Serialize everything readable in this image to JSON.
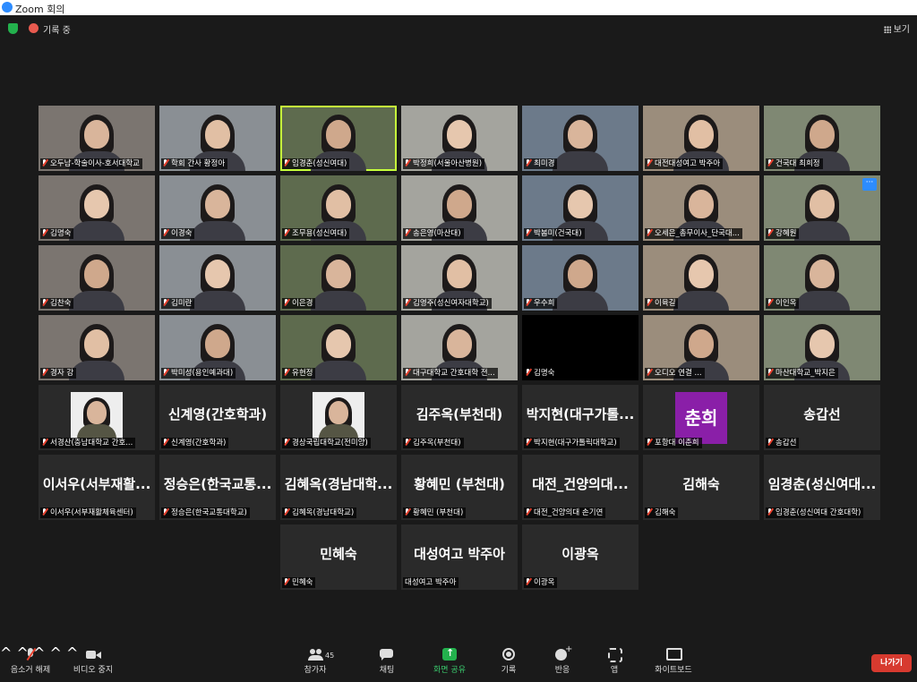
{
  "window": {
    "title": "Zoom 회의"
  },
  "topbar": {
    "recording": "기록 중",
    "view": "보기"
  },
  "participants": [
    {
      "label": "오두남-학술이사-호서대학교",
      "kind": "video"
    },
    {
      "label": "학회 간사 황정아",
      "kind": "video"
    },
    {
      "label": "임경춘(성신여대)",
      "kind": "video",
      "active": true
    },
    {
      "label": "박정희(서울아산병원)",
      "kind": "video"
    },
    {
      "label": "최미경",
      "kind": "video"
    },
    {
      "label": "대전대성여고 박주아",
      "kind": "video"
    },
    {
      "label": "건국대 최희정",
      "kind": "video"
    },
    {
      "label": "김명숙",
      "kind": "video"
    },
    {
      "label": "이경숙",
      "kind": "video"
    },
    {
      "label": "조무용(성신여대)",
      "kind": "video"
    },
    {
      "label": "송은영(마산대)",
      "kind": "video"
    },
    {
      "label": "박봄미(건국대)",
      "kind": "video"
    },
    {
      "label": "오세은_총무이사_단국대...",
      "kind": "video"
    },
    {
      "label": "강혜원",
      "kind": "video",
      "more": true
    },
    {
      "label": "김찬숙",
      "kind": "video"
    },
    {
      "label": "김미란",
      "kind": "video"
    },
    {
      "label": "이은경",
      "kind": "video"
    },
    {
      "label": "김영주(성신여자대학교)",
      "kind": "video"
    },
    {
      "label": "우수희",
      "kind": "video"
    },
    {
      "label": "이육길",
      "kind": "video"
    },
    {
      "label": "이인옥",
      "kind": "video"
    },
    {
      "label": "경자 강",
      "kind": "video"
    },
    {
      "label": "박미성(용인예과대)",
      "kind": "video"
    },
    {
      "label": "유현정",
      "kind": "video"
    },
    {
      "label": "대구대학교 간호대학 전...",
      "kind": "video"
    },
    {
      "label": "김명숙",
      "kind": "black"
    },
    {
      "label": "오디오 연결 ...",
      "kind": "video"
    },
    {
      "label": "마산대학교_박지은",
      "kind": "video"
    },
    {
      "label": "서경산(충남대학교 간호...",
      "kind": "photo"
    },
    {
      "label": "신계영(간호학과)",
      "kind": "name",
      "name": "신계영(간호학과)"
    },
    {
      "label": "경상국립대학교(전미양)",
      "kind": "photo"
    },
    {
      "label": "김주옥(부천대)",
      "kind": "name",
      "name": "김주옥(부천대)"
    },
    {
      "label": "박지현(대구가톨릭대학교)",
      "kind": "name",
      "name": "박지현(대구가톨..."
    },
    {
      "label": "포항대 이춘희",
      "kind": "avatar",
      "name": "춘희"
    },
    {
      "label": "송갑선",
      "kind": "name",
      "name": "송갑선"
    },
    {
      "label": "이서우(서부재활체육센터)",
      "kind": "name",
      "name": "이서우(서부재활..."
    },
    {
      "label": "정승은(한국교통대학교)",
      "kind": "name",
      "name": "정승은(한국교통..."
    },
    {
      "label": "김혜옥(경남대학교)",
      "kind": "name",
      "name": "김혜옥(경남대학..."
    },
    {
      "label": "황혜민 (부천대)",
      "kind": "name",
      "name": "황혜민 (부천대)"
    },
    {
      "label": "대전_건양의대 손기연",
      "kind": "name",
      "name": "대전_건양의대..."
    },
    {
      "label": "김해숙",
      "kind": "name",
      "name": "김해숙"
    },
    {
      "label": "임경춘(성신여대 간호대학)",
      "kind": "name",
      "name": "임경춘(성신여대..."
    },
    {
      "label": "민혜숙",
      "kind": "name",
      "name": "민혜숙"
    },
    {
      "label": "대성여고 박주아",
      "kind": "name",
      "name": "대성여고 박주아",
      "nomic": true
    },
    {
      "label": "이광옥",
      "kind": "name",
      "name": "이광옥"
    }
  ],
  "toolbar": {
    "mute": "음소거 해제",
    "video": "비디오 중지",
    "participants": "참가자",
    "participants_count": "45",
    "chat": "채팅",
    "share": "화면 공유",
    "record": "기록",
    "reactions": "반응",
    "apps": "앱",
    "whiteboard": "화이트보드",
    "leave": "나가기"
  },
  "colors": {
    "accent": "#2D8CFF",
    "share_green": "#23b14d",
    "leave_red": "#d73a2f",
    "active_speaker": "#c6ff3b"
  }
}
